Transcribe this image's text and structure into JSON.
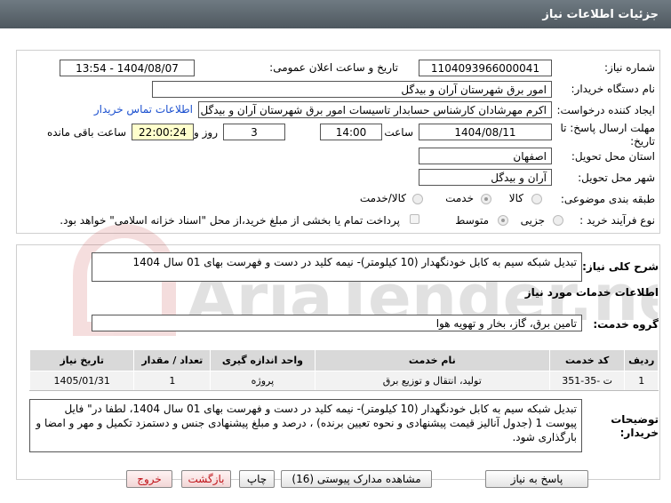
{
  "header": {
    "title": "جزئیات اطلاعات نیاز"
  },
  "form": {
    "need_number": {
      "label": "شماره نیاز:",
      "value": "1104093966000041"
    },
    "announce_date": {
      "label": "تاریخ و ساعت اعلان عمومی:",
      "value": "1404/08/07 - 13:54"
    },
    "buyer_org": {
      "label": "نام دستگاه خریدار:",
      "value": "امور برق شهرستان آران و بیدگل"
    },
    "creator": {
      "label": "ایجاد کننده درخواست:",
      "value": "اکرم مهرشادان کارشناس حسابدار تاسیسات امور برق شهرستان آران و بیدگل"
    },
    "contact_link": "اطلاعات تماس خریدار",
    "deadline": {
      "label_line1": "مهلت ارسال پاسخ: تا",
      "label_line2": "تاریخ:",
      "date": "1404/08/11",
      "time_label": "ساعت",
      "time": "14:00",
      "days": "3",
      "days_label": "روز و",
      "remaining": "22:00:24",
      "remaining_label": "ساعت باقی مانده"
    },
    "province": {
      "label": "استان محل تحویل:",
      "value": "اصفهان"
    },
    "city": {
      "label": "شهر محل تحویل:",
      "value": "آران و بیدگل"
    },
    "category": {
      "label": "طبقه بندی موضوعی:",
      "options": [
        "کالا",
        "خدمت",
        "کالا/خدمت"
      ],
      "selected": "خدمت"
    },
    "process_type": {
      "label": "نوع فرآیند خرید :",
      "options": [
        "جزیی",
        "متوسط"
      ],
      "selected": "متوسط",
      "payment_note": "پرداخت تمام یا بخشی از مبلغ خرید،از محل \"اسناد خزانه اسلامی\" خواهد بود."
    }
  },
  "summary": {
    "label": "شرح کلی نیاز:",
    "value": "تبدیل شبکه سیم به کابل خودنگهدار (10 کیلومتر)- نیمه کلید در دست و فهرست بهای 01 سال 1404"
  },
  "services": {
    "title": "اطلاعات خدمات مورد نیاز",
    "group_label": "گروه خدمت:",
    "group_value": "تامین برق، گاز، بخار و تهویه هوا",
    "columns": [
      "ردیف",
      "کد خدمت",
      "نام خدمت",
      "واحد اندازه گیری",
      "تعداد / مقدار",
      "تاریخ نیاز"
    ],
    "rows": [
      [
        "1",
        "ت -35-351",
        "تولید، انتقال و توزیع برق",
        "پروژه",
        "1",
        "1405/01/31"
      ]
    ]
  },
  "buyer_notes": {
    "label_line1": "توضیحات",
    "label_line2": "خریدار:",
    "text": "تبدیل شبکه سیم به کابل خودنگهدار (10 کیلومتر)- نیمه کلید در دست و فهرست بهای 01 سال 1404،  لطفا در\" فایل پیوست 1 (جدول آنالیز قیمت پیشنهادی و نحوه تعیین برنده) ، درصد و مبلغ پیشنهادی جنس و دستمزد  تکمیل و مهر و امضا و بارگذاری شود."
  },
  "watermark": "AriaTender.net",
  "buttons": {
    "reply": "پاسخ به نیاز",
    "docs": "مشاهده مدارک پیوستی (16)",
    "print": "چاپ",
    "back": "بازگشت",
    "exit": "خروج"
  }
}
